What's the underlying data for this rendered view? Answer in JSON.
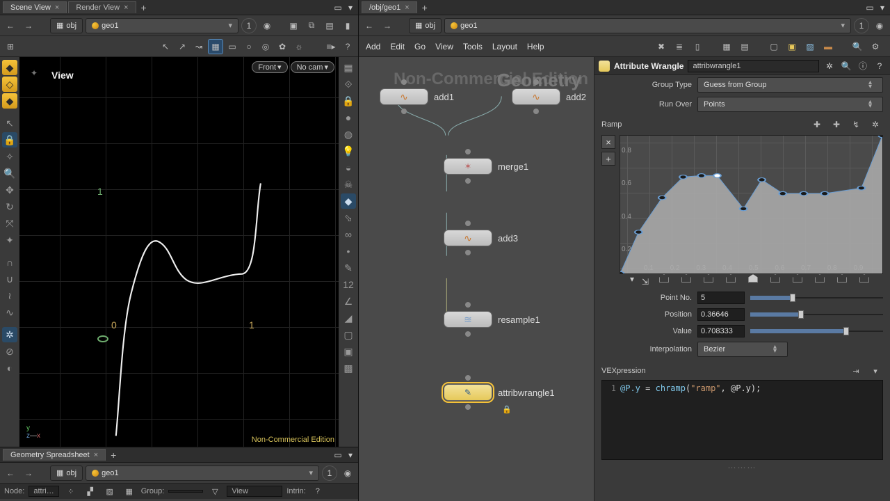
{
  "left": {
    "tabs": [
      "Scene View",
      "Render View"
    ],
    "active_tab": 0,
    "path": {
      "ctx": "obj",
      "node": "geo1",
      "pin": "1"
    },
    "view_label": "View",
    "drop_front": "Front",
    "drop_cam": "No cam",
    "axis": {
      "origin": "0",
      "one_y": "1",
      "one_x": "1"
    },
    "gizmo": {
      "y": "y",
      "x": "x",
      "z": "z"
    },
    "watermark": "Non-Commercial Edition"
  },
  "spreadsheet": {
    "tab": "Geometry Spreadsheet",
    "path": {
      "ctx": "obj",
      "node": "geo1",
      "pin": "1"
    },
    "footer": {
      "node_label": "Node:",
      "node_value": "attri…",
      "group_label": "Group:",
      "view_label": "View",
      "intrin_label": "Intrin:"
    }
  },
  "network": {
    "tab": "/obj/geo1",
    "path": {
      "ctx": "obj",
      "node": "geo1",
      "pin": "1"
    },
    "menus": [
      "Add",
      "Edit",
      "Go",
      "View",
      "Tools",
      "Layout",
      "Help"
    ],
    "watermark": "Non-Commercial Edition",
    "big_label": "Geometry",
    "nodes": {
      "add1": "add1",
      "add2": "add2",
      "merge1": "merge1",
      "add3": "add3",
      "resample1": "resample1",
      "attribwrangle1": "attribwrangle1"
    }
  },
  "params": {
    "title": "Attribute Wrangle",
    "name": "attribwrangle1",
    "group_type": {
      "label": "Group Type",
      "value": "Guess from Group"
    },
    "run_over": {
      "label": "Run Over",
      "value": "Points"
    },
    "ramp_label": "Ramp",
    "point_no": {
      "label": "Point No.",
      "value": "5"
    },
    "position": {
      "label": "Position",
      "value": "0.36646"
    },
    "value": {
      "label": "Value",
      "value": "0.708333"
    },
    "interp": {
      "label": "Interpolation",
      "value": "Bezier"
    },
    "vex_label": "VEXpression",
    "vex_code": "@P.y = chramp(\"ramp\", @P.y);",
    "ramp_xticks": [
      "0.1",
      "0.2",
      "0.3",
      "0.4",
      "0.5",
      "0.6",
      "0.7",
      "0.8",
      "0.9"
    ],
    "ramp_yticks": [
      "0.2",
      "0.4",
      "0.6",
      "0.8"
    ]
  },
  "chart_data": {
    "type": "line",
    "title": "Ramp",
    "xlabel": "",
    "ylabel": "",
    "xlim": [
      0,
      1
    ],
    "ylim": [
      0,
      1
    ],
    "x": [
      0.0,
      0.07,
      0.16,
      0.24,
      0.31,
      0.37,
      0.47,
      0.54,
      0.62,
      0.7,
      0.78,
      0.92,
      1.0
    ],
    "values": [
      0.0,
      0.3,
      0.55,
      0.7,
      0.71,
      0.71,
      0.47,
      0.68,
      0.58,
      0.58,
      0.58,
      0.62,
      1.0
    ],
    "selected_point_index": 5,
    "interpolation": "Bezier"
  }
}
